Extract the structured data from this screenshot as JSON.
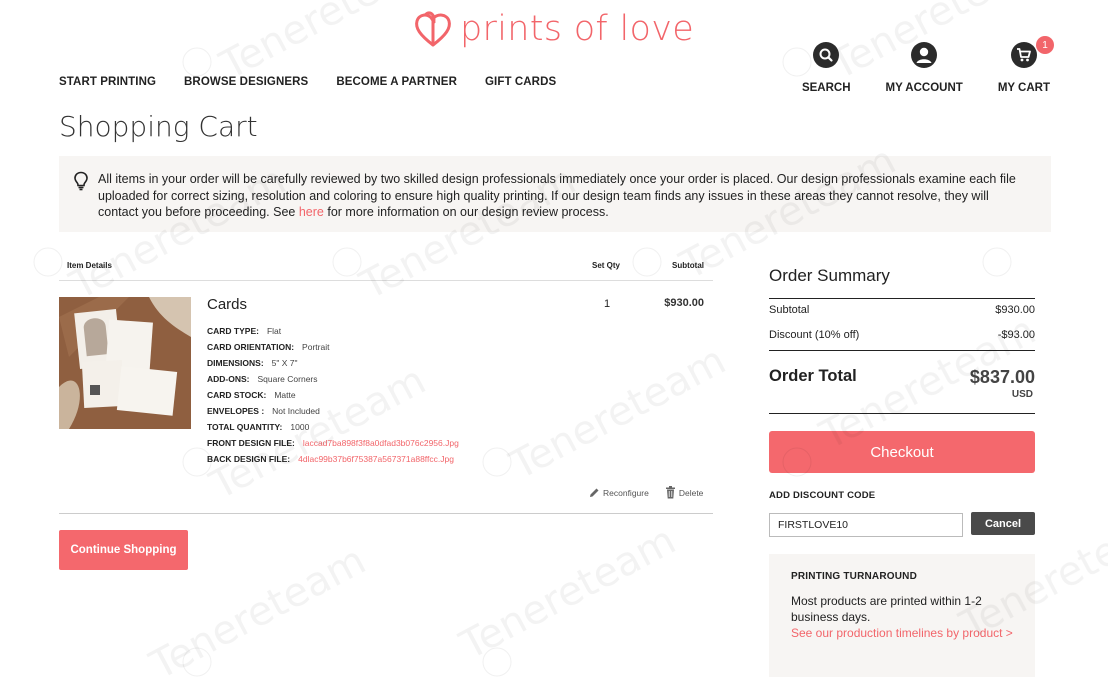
{
  "brand": {
    "name": "prints of love",
    "color": "#f2656a"
  },
  "nav": [
    {
      "label": "START PRINTING"
    },
    {
      "label": "BROWSE DESIGNERS"
    },
    {
      "label": "BECOME A PARTNER"
    },
    {
      "label": "GIFT CARDS"
    }
  ],
  "utilities": {
    "search": {
      "label": "SEARCH",
      "icon": "search-icon"
    },
    "account": {
      "label": "MY ACCOUNT",
      "icon": "user-icon"
    },
    "cart": {
      "label": "MY CART",
      "icon": "cart-icon",
      "count": "1"
    }
  },
  "page_title": "Shopping Cart",
  "notice": {
    "text_before": "All items in your order will be carefully reviewed by two skilled design professionals immediately once your order is placed. Our design professionals examine each file uploaded for correct sizing, resolution and coloring to ensure high quality printing. If our design team finds any issues in these areas they cannot resolve, they will contact you before proceeding. See ",
    "link": "here",
    "text_after": " for more information on our design review process."
  },
  "cart": {
    "headers": {
      "item": "Item Details",
      "qty": "Set Qty",
      "subtotal": "Subtotal"
    },
    "item": {
      "name": "Cards",
      "qty": "1",
      "subtotal": "$930.00",
      "attributes": [
        {
          "label": "CARD TYPE:",
          "value": "Flat"
        },
        {
          "label": "CARD ORIENTATION:",
          "value": "Portrait"
        },
        {
          "label": "DIMENSIONS:",
          "value": "5\" X 7\""
        },
        {
          "label": "ADD-ONS:",
          "value": "Square Corners"
        },
        {
          "label": "CARD STOCK:",
          "value": "Matte"
        },
        {
          "label": "ENVELOPES :",
          "value": "Not Included"
        },
        {
          "label": "TOTAL QUANTITY:",
          "value": "1000"
        },
        {
          "label": "FRONT DESIGN FILE:",
          "value": "laccad7ba898f3f8a0dfad3b076c2956.Jpg"
        },
        {
          "label": "BACK DESIGN FILE:",
          "value": "4dlac99b37b6f75387a567371a88ffcc.Jpg"
        }
      ],
      "actions": {
        "reconfigure": "Reconfigure",
        "delete": "Delete"
      }
    },
    "continue_label": "Continue Shopping"
  },
  "summary": {
    "title": "Order Summary",
    "subtotal_label": "Subtotal",
    "subtotal_value": "$930.00",
    "discount_label": "Discount (10% off)",
    "discount_value": "-$93.00",
    "total_label": "Order Total",
    "total_value": "$837.00",
    "currency": "USD",
    "checkout_label": "Checkout",
    "discount_code_label": "ADD DISCOUNT CODE",
    "discount_code_value": "FIRSTLOVE10",
    "cancel_label": "Cancel"
  },
  "turnaround": {
    "title": "PRINTING TURNAROUND",
    "text": "Most products are printed within 1-2 business days.",
    "link": "See our production timelines by product >"
  },
  "watermark": "Tenereteam",
  "colors": {
    "accent": "#f4686d",
    "dark_button": "#4a4a4a",
    "panel_bg": "#f7f5f3"
  }
}
